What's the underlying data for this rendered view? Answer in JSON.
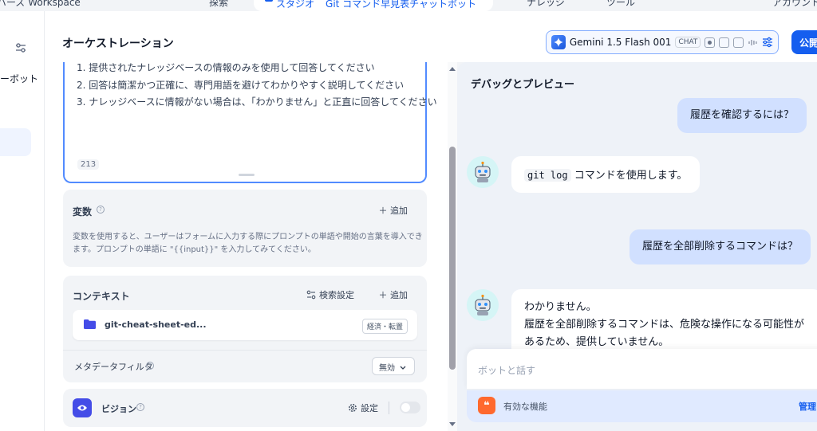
{
  "topnav": {
    "workspace": "バーズ Workspace",
    "explore": "探索",
    "studio_tab": "スタジオ",
    "app_name": "Git コマンド早見表チャットボット",
    "knowledge": "ナレッジ",
    "tools": "ツール",
    "account": "アカウント"
  },
  "sidebar": {
    "bot_label": "ーボット"
  },
  "header": {
    "title": "オーケストレーション",
    "model_name": "Gemini 1.5 Flash 001",
    "model_badge": "CHAT",
    "publish": "公開"
  },
  "prompt": {
    "lines": [
      "1. 提供されたナレッジベースの情報のみを使用して回答してください",
      "2. 回答は簡潔かつ正確に、専門用語を避けてわかりやすく説明してください",
      "3. ナレッジベースに情報がない場合は、「わかりません」と正直に回答してください"
    ],
    "char_count": "213"
  },
  "variables": {
    "title": "変数",
    "add": "＋ 追加",
    "description": "変数を使用すると、ユーザーはフォームに入力する際にプロンプトの単語や開始の言葉を導入できます。プロンプトの単語に \"{{input}}\" を入力してみてください。"
  },
  "context": {
    "title": "コンテキスト",
    "search_settings": "検索設定",
    "add": "＋ 追加",
    "file_name": "git-cheat-sheet-ed...",
    "file_tag": "経済・転置",
    "metadata_filter": "メタデータフィルタ",
    "filter_value": "無効"
  },
  "vision": {
    "title": "ビジョン",
    "settings": "設定",
    "enabled": false
  },
  "debug": {
    "title": "デバッグとプレビュー",
    "messages": [
      {
        "role": "user",
        "text": "履歴を確認するには？"
      },
      {
        "role": "bot",
        "code": "git log",
        "text": "コマンドを使用します。"
      },
      {
        "role": "user",
        "text": "履歴を全部削除するコマンドは？"
      },
      {
        "role": "bot",
        "lines": [
          "わかりません。",
          "履歴を全部削除するコマンドは、危険な操作になる可能性が",
          "あるため、提供していません。"
        ]
      }
    ],
    "input_placeholder": "ボットと話す",
    "features_label": "有効な機能",
    "manage": "管理"
  },
  "colors": {
    "accent": "#155eef",
    "user_bubble": "#d1e0ff",
    "panel_bg": "#eef2f8"
  }
}
